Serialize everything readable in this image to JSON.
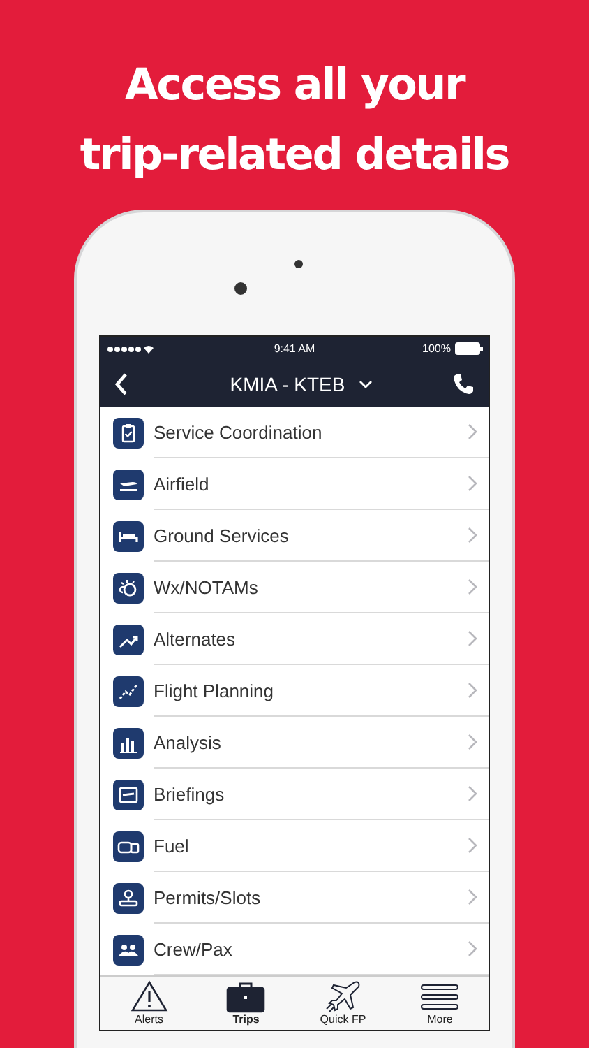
{
  "headline": [
    "Access all your",
    "trip-related details"
  ],
  "status_bar": {
    "time": "9:41 AM",
    "battery": "100%"
  },
  "nav_bar": {
    "title": "KMIA - KTEB"
  },
  "menu": [
    {
      "label": "Service Coordination"
    },
    {
      "label": "Airfield"
    },
    {
      "label": "Ground Services"
    },
    {
      "label": "Wx/NOTAMs"
    },
    {
      "label": "Alternates"
    },
    {
      "label": "Flight Planning"
    },
    {
      "label": "Analysis"
    },
    {
      "label": "Briefings"
    },
    {
      "label": "Fuel"
    },
    {
      "label": "Permits/Slots"
    },
    {
      "label": "Crew/Pax"
    }
  ],
  "tab_bar": [
    {
      "label": "Alerts",
      "kind": "alerts",
      "selected": false
    },
    {
      "label": "Trips",
      "kind": "trips",
      "selected": true
    },
    {
      "label": "Quick FP",
      "kind": "plane",
      "selected": false
    },
    {
      "label": "More",
      "kind": "menu",
      "selected": false
    }
  ]
}
